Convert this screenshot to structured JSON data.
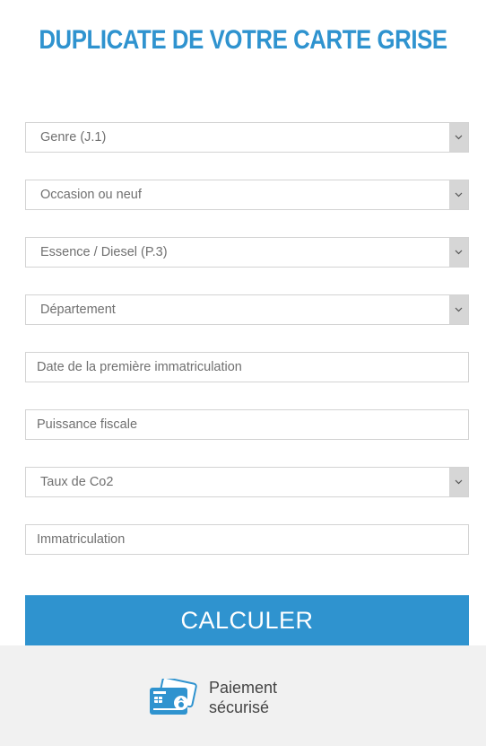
{
  "title": "DUPLICATE DE VOTRE CARTE GRISE",
  "form": {
    "genre": {
      "placeholder": "Genre (J.1)"
    },
    "occasion": {
      "placeholder": "Occasion ou neuf"
    },
    "energie": {
      "placeholder": "Essence / Diesel (P.3)"
    },
    "departement": {
      "placeholder": "Département"
    },
    "date": {
      "placeholder": "Date de la première immatriculation"
    },
    "puissance": {
      "placeholder": "Puissance fiscale"
    },
    "co2": {
      "placeholder": "Taux de Co2"
    },
    "immatriculation": {
      "placeholder": "Immatriculation"
    }
  },
  "submit_label": "CALCULER",
  "footer": {
    "icon": "credit-card-icon",
    "line1": "Paiement",
    "line2": "sécurisé"
  },
  "colors": {
    "accent": "#2f93cf",
    "footer_bg": "#f1f1f1"
  }
}
